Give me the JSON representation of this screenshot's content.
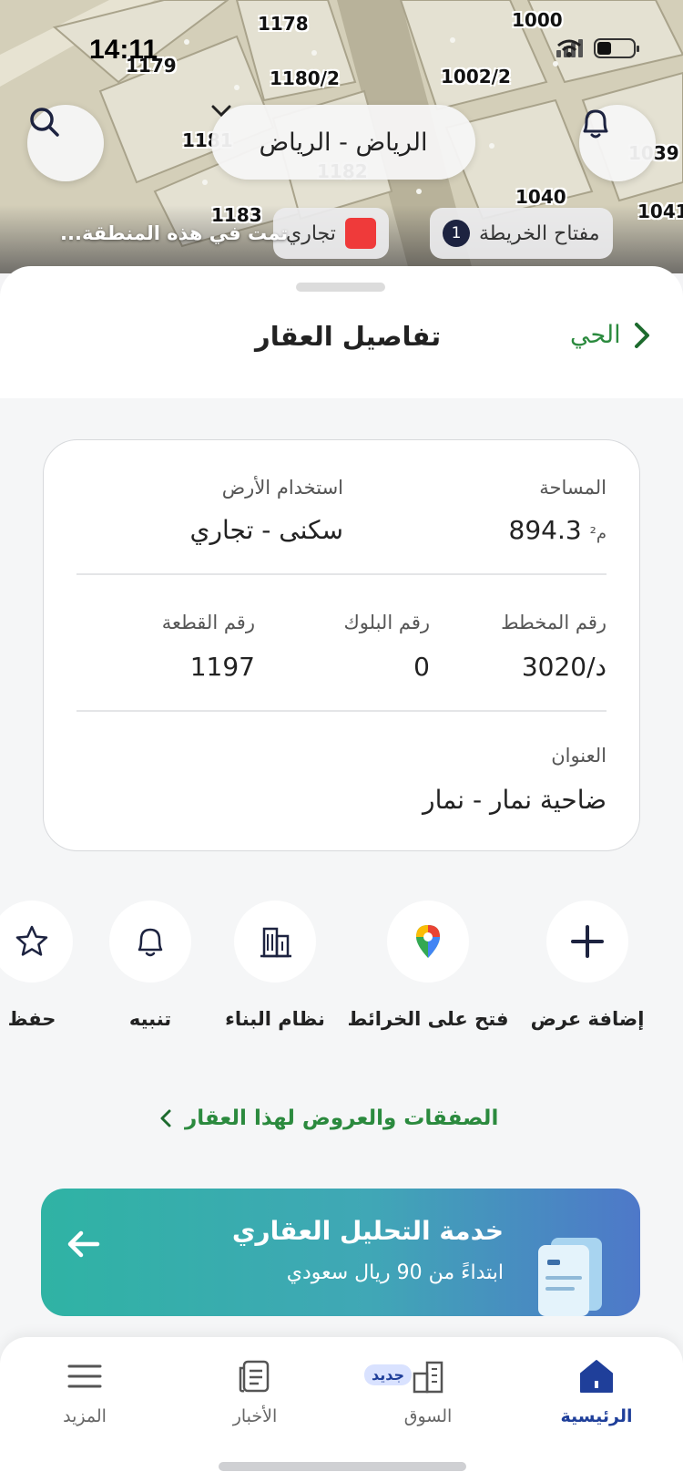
{
  "status_bar": {
    "time": "14:11"
  },
  "map": {
    "city_selector": "الرياض - الرياض",
    "plots": [
      "1178",
      "1000",
      "1179",
      "1180/2",
      "1002/2",
      "1181",
      "1182",
      "1039",
      "1040",
      "1041",
      "1183"
    ],
    "legend_chip": "مفتاح الخريطة",
    "filter_count": "1",
    "filter_chip": "تجاري",
    "caption": "...تمت في هذه المنطقة"
  },
  "sheet": {
    "title": "تفاصيل العقار",
    "back_link": "الحي"
  },
  "details": {
    "area_label": "المساحة",
    "area_value": "894.3",
    "area_unit": "م²",
    "land_use_label": "استخدام الأرض",
    "land_use_value": "سكنى - تجاري",
    "plan_label": "رقم المخطط",
    "plan_value": "3020/د",
    "block_label": "رقم البلوك",
    "block_value": "0",
    "plot_label": "رقم القطعة",
    "plot_value": "1197",
    "address_label": "العنوان",
    "address_value": "ضاحية نمار - نمار"
  },
  "actions": [
    {
      "label": "إضافة عرض",
      "icon": "plus-icon"
    },
    {
      "label": "فتح على الخرائط",
      "icon": "map-pin-icon"
    },
    {
      "label": "نظام البناء",
      "icon": "building-icon"
    },
    {
      "label": "تنبيه",
      "icon": "bell-icon"
    },
    {
      "label": "حفظ",
      "icon": "star-icon"
    }
  ],
  "deals_link": "الصفقات والعروض لهذا العقار",
  "promo": {
    "title": "خدمة التحليل العقاري",
    "subtitle": "ابتداءً من 90 ريال سعودي"
  },
  "tabbar": {
    "tabs": [
      {
        "label": "الرئيسية",
        "icon": "home-icon"
      },
      {
        "label": "السوق",
        "icon": "market-icon"
      },
      {
        "label": "الأخبار",
        "icon": "news-icon"
      },
      {
        "label": "المزيد",
        "icon": "menu-icon"
      }
    ],
    "new_badge": "جديد"
  },
  "colors": {
    "green": "#2b8a3e",
    "navy": "#1f3f9a",
    "promo_start": "#2fb3a4",
    "promo_end": "#4e78c9"
  }
}
